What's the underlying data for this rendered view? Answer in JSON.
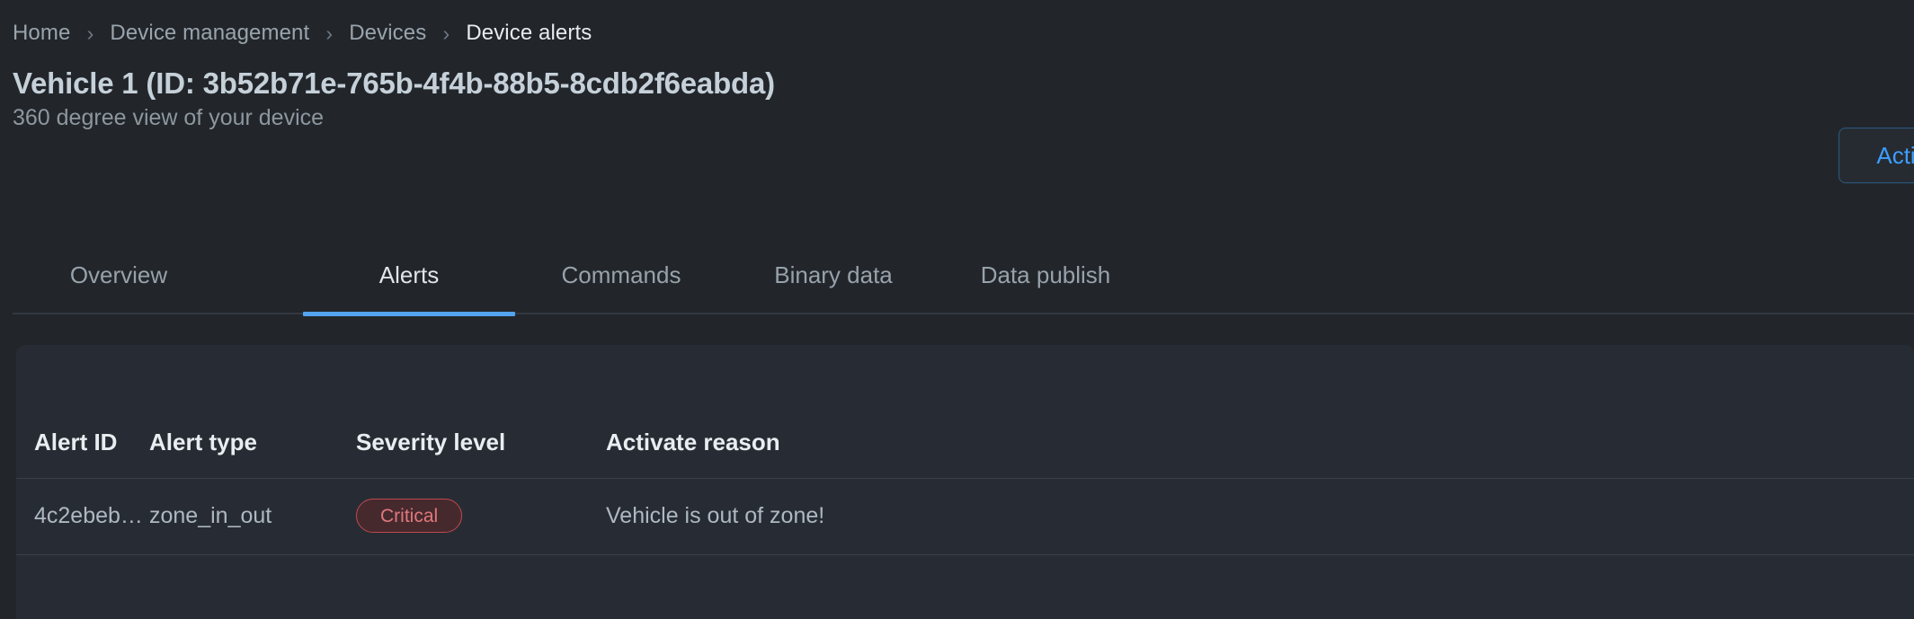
{
  "breadcrumb": {
    "separator": "›",
    "items": [
      {
        "label": "Home",
        "active": false
      },
      {
        "label": "Device management",
        "active": false
      },
      {
        "label": "Devices",
        "active": false
      },
      {
        "label": "Device alerts",
        "active": true
      }
    ]
  },
  "header": {
    "title": "Vehicle 1 (ID: 3b52b71e-765b-4f4b-88b5-8cdb2f6eabda)",
    "subtitle": "360 degree view of your device",
    "actions_button_label": "Actions"
  },
  "tabs": [
    {
      "label": "Overview",
      "active": false
    },
    {
      "label": "Alerts",
      "active": true
    },
    {
      "label": "Commands",
      "active": false
    },
    {
      "label": "Binary data",
      "active": false
    },
    {
      "label": "Data publish",
      "active": false
    }
  ],
  "table": {
    "columns": [
      "Alert ID",
      "Alert type",
      "Severity level",
      "Activate reason"
    ],
    "rows": [
      {
        "alert_id": "4c2ebeb…",
        "alert_type": "zone_in_out",
        "severity": "Critical",
        "activate_reason": "Vehicle is out of zone!"
      }
    ]
  },
  "colors": {
    "page_background": "#22262b",
    "card_background": "#272c34",
    "accent_blue": "#54a3f0",
    "link_blue": "#3d9dfd",
    "critical_border": "#c0494f",
    "critical_fill": "#45292d",
    "critical_text": "#e0787c",
    "divider": "#39414a"
  }
}
